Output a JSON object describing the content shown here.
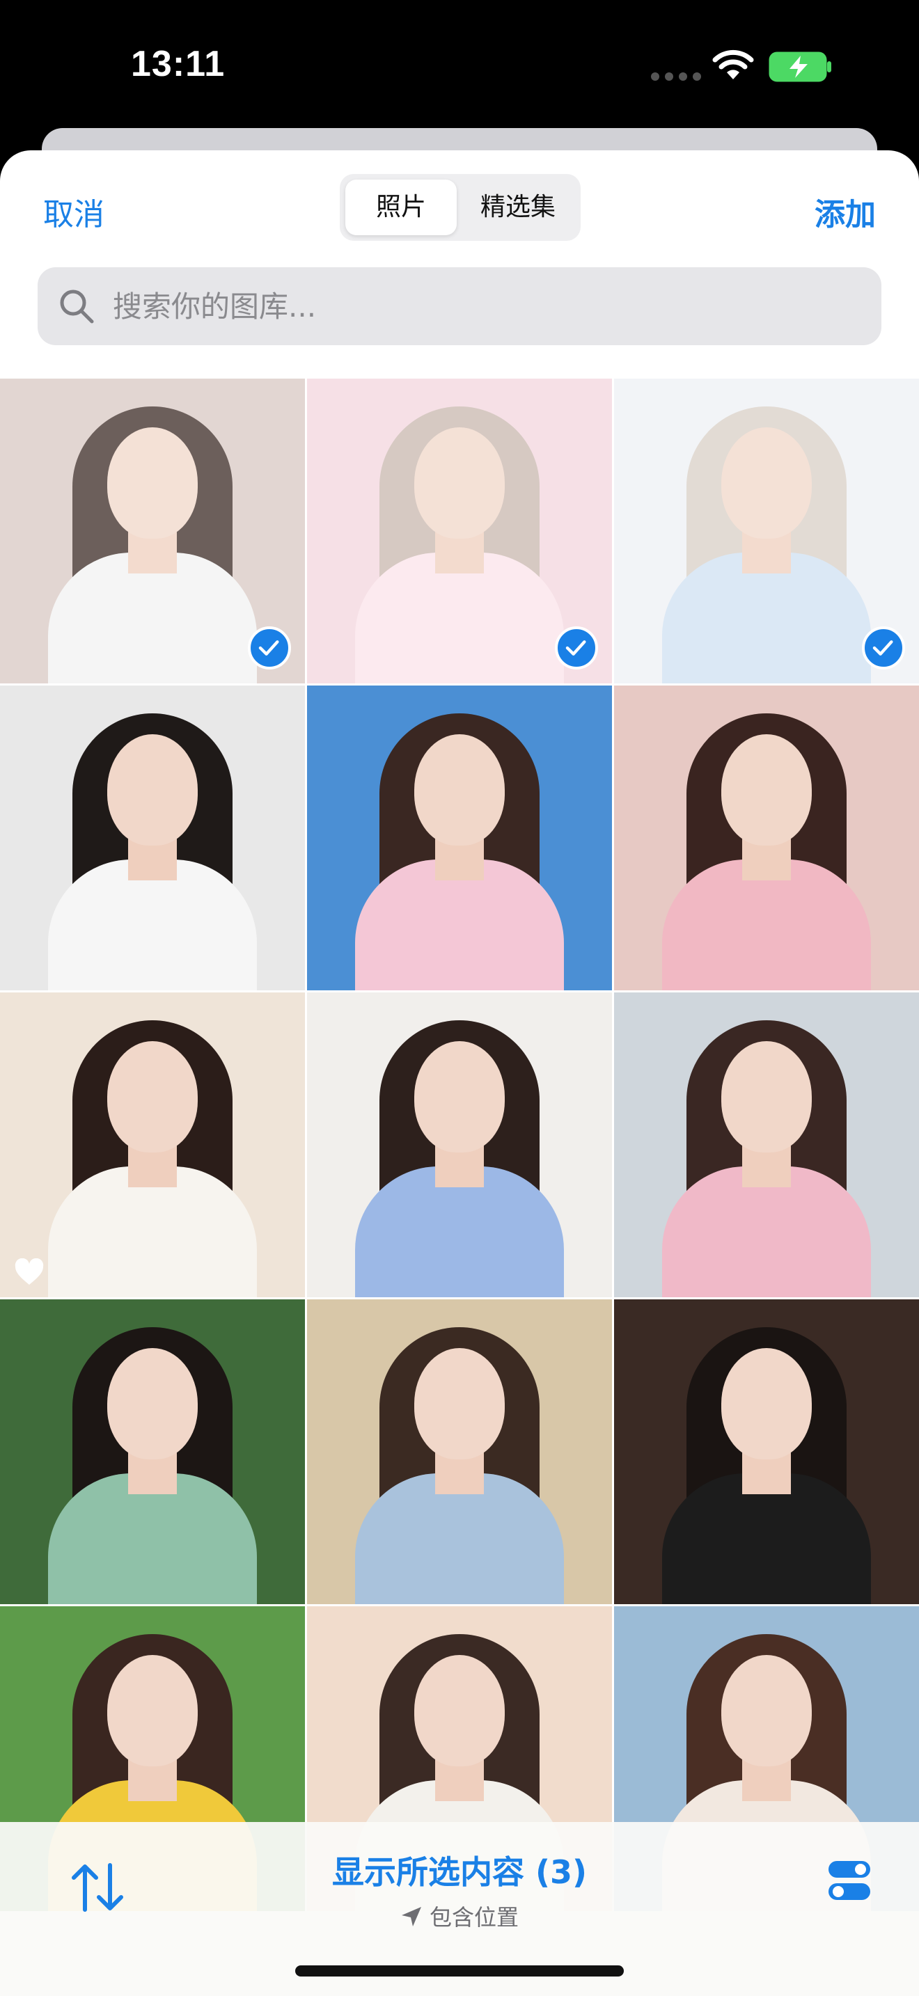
{
  "status_bar": {
    "time": "13:11"
  },
  "nav": {
    "cancel_label": "取消",
    "add_label": "添加",
    "segments": [
      "照片",
      "精选集"
    ],
    "selected_segment": "照片"
  },
  "search": {
    "placeholder": "搜索你的图库...",
    "value": ""
  },
  "photos": [
    {
      "selected": true,
      "favorite": false,
      "icon": "photo-portrait"
    },
    {
      "selected": true,
      "favorite": false,
      "icon": "photo-portrait"
    },
    {
      "selected": true,
      "favorite": false,
      "icon": "photo-portrait"
    },
    {
      "selected": false,
      "favorite": false,
      "icon": "photo-portrait"
    },
    {
      "selected": false,
      "favorite": false,
      "icon": "photo-portrait"
    },
    {
      "selected": false,
      "favorite": false,
      "icon": "photo-portrait"
    },
    {
      "selected": false,
      "favorite": true,
      "icon": "photo-portrait"
    },
    {
      "selected": false,
      "favorite": false,
      "icon": "photo-portrait"
    },
    {
      "selected": false,
      "favorite": false,
      "icon": "photo-portrait"
    },
    {
      "selected": false,
      "favorite": false,
      "icon": "photo-portrait"
    },
    {
      "selected": false,
      "favorite": false,
      "icon": "photo-portrait"
    },
    {
      "selected": false,
      "favorite": false,
      "icon": "photo-portrait"
    },
    {
      "selected": false,
      "favorite": false,
      "icon": "photo-portrait"
    },
    {
      "selected": false,
      "favorite": false,
      "icon": "photo-portrait"
    },
    {
      "selected": false,
      "favorite": false,
      "icon": "photo-portrait"
    }
  ],
  "bottom_bar": {
    "show_selected_label": "显示所选内容 (3)",
    "location_label": "包含位置"
  },
  "colors": {
    "accent": "#1a80e6",
    "sheet": "#ffffff",
    "search_bg": "#e6e6e9"
  }
}
